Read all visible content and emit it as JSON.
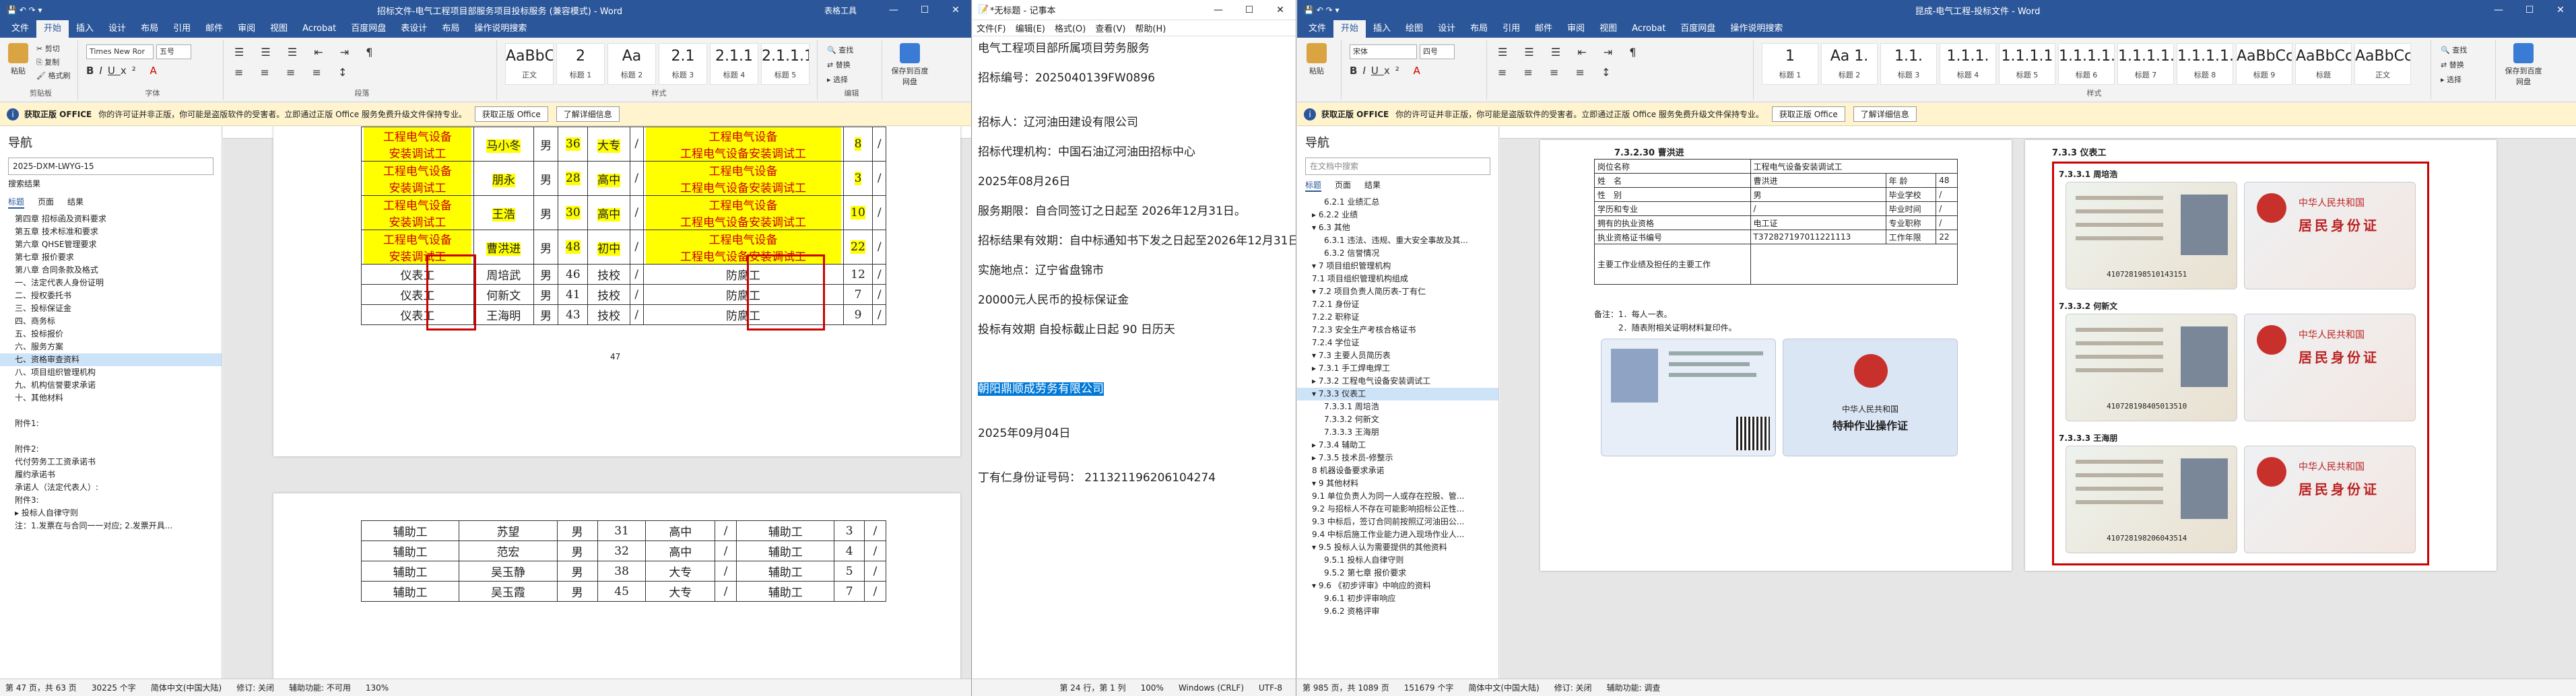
{
  "left_window": {
    "title": "招标文件-电气工程项目部服务项目投标服务 (兼容模式) - Word",
    "context_tab": "表格工具",
    "tabs": [
      "文件",
      "开始",
      "插入",
      "设计",
      "布局",
      "引用",
      "邮件",
      "审阅",
      "视图",
      "Acrobat",
      "百度网盘",
      "表设计",
      "布局",
      "操作说明搜索"
    ],
    "ribbon": {
      "paste": "粘贴",
      "cut": "剪切",
      "copy": "复制",
      "format_painter": "格式刷",
      "clipboard": "剪贴板",
      "font_name": "Times New Ror",
      "font_size": "五号",
      "font": "字体",
      "paragraph": "段落",
      "styles_label": "样式",
      "find": "查找",
      "replace": "替换",
      "select": "选择",
      "editing": "编辑",
      "save_baidu": "保存到百度网盘",
      "save_group": "保存",
      "styles": [
        {
          "preview": "AaBbC",
          "name": "正文"
        },
        {
          "preview": "2",
          "name": "标题 1"
        },
        {
          "preview": "Aa",
          "name": "标题 2"
        },
        {
          "preview": "2.1",
          "name": "标题 3"
        },
        {
          "preview": "2.1.1",
          "name": "标题 4"
        },
        {
          "preview": "2.1.1.1",
          "name": "标题 5"
        }
      ]
    },
    "warning": {
      "bold": "获取正版 OFFICE",
      "text": "你的许可证并非正版，你可能是盗版软件的受害者。立即通过正版 Office 服务免费升级文件保持专业。",
      "btn1": "获取正版 Office",
      "btn2": "了解详细信息"
    },
    "nav": {
      "title": "导航",
      "search": "2025-DXM-LWYG-15",
      "result": "搜索结果",
      "tabs": [
        "标题",
        "页面",
        "结果"
      ],
      "items": [
        "第四章 招标函及资料要求",
        "第五章 技术标准和要求",
        "第六章 QHSE管理要求",
        "第七章 报价要求",
        "第八章 合同条款及格式",
        "一、法定代表人身份证明",
        "二、授权委托书",
        "三、投标保证金",
        "四、商务标",
        "五、投标报价",
        "六、服务方案",
        "七、资格审查资料",
        "八、项目组织管理机构",
        "九、机构信誉要求承诺",
        "十、其他材料",
        "",
        "附件1:",
        "",
        "附件2:",
        "代付劳务工工资承诺书",
        "履约承诺书",
        "承诺人（法定代表人）:",
        "附件3:",
        "▸ 投标人自律守则",
        "注：1.发票在与合同一一对应;  2.发票开具..."
      ],
      "selected_index": 11
    },
    "table1_rows": [
      [
        "安装调试工",
        "马小冬",
        "男",
        "36",
        "大专",
        "/",
        "工程电气设备安装调试工",
        "8",
        "/"
      ],
      [
        "安装调试工",
        "朋永",
        "男",
        "28",
        "高中",
        "/",
        "工程电气设备安装调试工",
        "3",
        "/"
      ],
      [
        "安装调试工",
        "王浩",
        "男",
        "30",
        "高中",
        "/",
        "工程电气设备安装调试工",
        "10",
        "/"
      ],
      [
        "安装调试工",
        "曹洪进",
        "男",
        "48",
        "初中",
        "/",
        "工程电气设备安装调试工",
        "22",
        "/"
      ],
      [
        "仪表工",
        "周培武",
        "男",
        "46",
        "技校",
        "/",
        "防腐工",
        "12",
        "/"
      ],
      [
        "仪表工",
        "何新文",
        "男",
        "41",
        "技校",
        "/",
        "防腐工",
        "7",
        "/"
      ],
      [
        "仪表工",
        "王海明",
        "男",
        "43",
        "技校",
        "/",
        "防腐工",
        "9",
        "/"
      ]
    ],
    "row_prefix": "工程电气设备",
    "page_number": "47",
    "table2_rows": [
      [
        "辅助工",
        "苏望",
        "男",
        "31",
        "高中",
        "/",
        "辅助工",
        "3",
        "/"
      ],
      [
        "辅助工",
        "范宏",
        "男",
        "32",
        "高中",
        "/",
        "辅助工",
        "4",
        "/"
      ],
      [
        "辅助工",
        "吴玉静",
        "男",
        "38",
        "大专",
        "/",
        "辅助工",
        "5",
        "/"
      ],
      [
        "辅助工",
        "吴玉霞",
        "男",
        "45",
        "大专",
        "/",
        "辅助工",
        "7",
        "/"
      ]
    ],
    "status": [
      "第 47 页，共 63 页",
      "30225 个字",
      "简体中文(中国大陆)",
      "修订: 关闭",
      "辅助功能: 不可用",
      "130%"
    ]
  },
  "notepad": {
    "title": "*无标题 - 记事本",
    "menu": [
      "文件(F)",
      "编辑(E)",
      "格式(O)",
      "查看(V)",
      "帮助(H)"
    ],
    "lines": [
      "电气工程项目部所属项目劳务服务",
      "",
      "招标编号：2025040139FW0896",
      "",
      "",
      "招标人：辽河油田建设有限公司",
      "",
      "招标代理机构：中国石油辽河油田招标中心",
      "",
      "2025年08月26日",
      "",
      "服务期限：自合同签订之日起至 2026年12月31日。",
      "",
      "招标结果有效期：自中标通知书下发之日起至2026年12月31日。",
      "",
      "实施地点：辽宁省盘锦市",
      "",
      "20000元人民币的投标保证金",
      "",
      "投标有效期 自投标截止日起 90 日历天",
      "",
      "",
      "",
      "",
      "",
      "2025年09月04日",
      "",
      "",
      "丁有仁身份证号码： 211321196206104274"
    ],
    "selected_line": "朝阳鼎顺成劳务有限公司",
    "selected_after_index": 23,
    "status": [
      "第 24 行，第 1 列",
      "100%",
      "Windows (CRLF)",
      "UTF-8"
    ]
  },
  "right_window": {
    "title": "昆成-电气工程-投标文件 - Word",
    "tabs": [
      "文件",
      "开始",
      "插入",
      "绘图",
      "设计",
      "布局",
      "引用",
      "邮件",
      "审阅",
      "视图",
      "Acrobat",
      "百度网盘",
      "操作说明搜索"
    ],
    "ribbon": {
      "paste": "粘贴",
      "font_name": "宋体",
      "font_size": "四号",
      "styles": [
        {
          "preview": "1",
          "name": "标题 1"
        },
        {
          "preview": "Aa 1.",
          "name": "标题 2"
        },
        {
          "preview": "1.1.",
          "name": "标题 3"
        },
        {
          "preview": "1.1.1.",
          "name": "标题 4"
        },
        {
          "preview": "1.1.1.1",
          "name": "标题 5"
        },
        {
          "preview": "1.1.1.1.",
          "name": "标题 6"
        },
        {
          "preview": "1.1.1.1.1",
          "name": "标题 7"
        },
        {
          "preview": "1.1.1.1.1.",
          "name": "标题 8"
        },
        {
          "preview": "AaBbCcDc",
          "name": "标题 9"
        },
        {
          "preview": "AaBbCc",
          "name": "标题"
        },
        {
          "preview": "AaBbCcDd",
          "name": "正文"
        }
      ],
      "styles_label": "样式",
      "find": "查找",
      "replace": "替换",
      "select": "选择",
      "save_baidu": "保存到百度网盘"
    },
    "warning": {
      "bold": "获取正版 OFFICE",
      "text": "你的许可证并非正版，你可能是盗版软件的受害者。立即通过正版 Office 服务免费升级文件保持专业。",
      "btn1": "获取正版 Office",
      "btn2": "了解详细信息"
    },
    "nav": {
      "title": "导航",
      "search": "在文档中搜索",
      "tabs": [
        "标题",
        "页面",
        "结果"
      ],
      "items": [
        "6.2.1 业绩汇总",
        "▸ 6.2.2 业绩",
        "▾ 6.3 其他",
        "6.3.1 违法、违规、重大安全事故及其...",
        "6.3.2 信誉情况",
        "▾ 7 项目组织管理机构",
        "7.1 项目组织管理机构组成",
        "▾ 7.2 项目负责人简历表-丁有仁",
        "7.2.1 身份证",
        "7.2.2 职称证",
        "7.2.3 安全生产考核合格证书",
        "7.2.4 学位证",
        "▾ 7.3 主要人员简历表",
        "▸ 7.3.1 手工焊电焊工",
        "▸ 7.3.2 工程电气设备安装调试工",
        "▾ 7.3.3 仪表工",
        "7.3.3.1 周培浩",
        "7.3.3.2 何新文",
        "7.3.3.3 王海朋",
        "▸ 7.3.4 辅助工",
        "▸ 7.3.5 技术员-修整示",
        "8 机器设备要求承诺",
        "▾ 9 其他材料",
        "9.1 单位负责人为同一人或存在控股、管...",
        "9.2 与招标人不存在可能影响招标公正性...",
        "9.3 中标后，签订合同前按照辽河油田公...",
        "9.4 中标后施工作业能力进入现场作业人...",
        "▾ 9.5 投标人认为需要提供的其他资料",
        "9.5.1 投标人自律守则",
        "9.5.2 第七章 报价要求",
        "▾ 9.6 《初步评审》中响应的资料",
        "9.6.1 初步评审响应",
        "9.6.2 资格评审"
      ],
      "selected_index": 15
    },
    "form": {
      "heading": "7.3.2.30 曹洪进",
      "rows": [
        [
          "岗位名称",
          "工程电气设备安装调试工",
          "",
          ""
        ],
        [
          "姓　名",
          "曹洪进",
          "年 龄",
          "48"
        ],
        [
          "性　别",
          "男",
          "毕业学校",
          "/"
        ],
        [
          "学历和专业",
          "/",
          "毕业时间",
          "/"
        ],
        [
          "拥有的执业资格",
          "电工证",
          "专业职称",
          "/"
        ],
        [
          "执业资格证书编号",
          "T372827197011221113",
          "工作年限",
          "22"
        ]
      ],
      "last_row": "主要工作业绩及担任的主要工作",
      "note1": "备注：1．每人一表。",
      "note2": "2．随表附相关证明材料复印件。",
      "cert_title": "中华人民共和国",
      "cert_sub": "特种作业操作证"
    },
    "idcards_heading": "7.3.3 仪表工",
    "idcards": [
      {
        "heading": "7.3.3.1 周培浩",
        "number": "410728198510143151"
      },
      {
        "heading": "7.3.3.2 何新文",
        "number": "410728198405013510"
      },
      {
        "heading": "7.3.3.3 王海朋",
        "number": "410728198206043514"
      }
    ],
    "id_back_title": "中华人民共和国",
    "id_back_sub": "居民身份证",
    "status": [
      "第 985 页，共 1089 页",
      "151679 个字",
      "简体中文(中国大陆)",
      "修订: 关闭",
      "辅助功能: 调查"
    ]
  }
}
